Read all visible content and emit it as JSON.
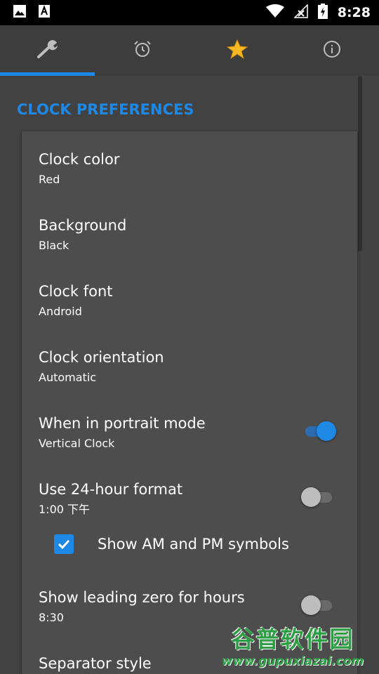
{
  "status_bar": {
    "time": "8:28",
    "icons": [
      "image-icon",
      "a-icon",
      "wifi-icon",
      "signal-icon",
      "battery-icon"
    ]
  },
  "tabs": [
    {
      "icon": "wrench-icon",
      "selected": true
    },
    {
      "icon": "alarm-icon",
      "selected": false
    },
    {
      "icon": "star-icon",
      "selected": false
    },
    {
      "icon": "info-icon",
      "selected": false
    }
  ],
  "section_title": "CLOCK PREFERENCES",
  "prefs": {
    "clock_color": {
      "title": "Clock color",
      "value": "Red"
    },
    "background": {
      "title": "Background",
      "value": "Black"
    },
    "clock_font": {
      "title": "Clock font",
      "value": "Android"
    },
    "clock_orientation": {
      "title": "Clock orientation",
      "value": "Automatic"
    },
    "portrait_mode": {
      "title": "When in portrait mode",
      "value": "Vertical Clock",
      "enabled": true
    },
    "hour_format": {
      "title": "Use 24-hour format",
      "value": "1:00 下午",
      "enabled": false
    },
    "am_pm": {
      "label": "Show AM and PM symbols",
      "checked": true
    },
    "leading_zero": {
      "title": "Show leading zero for hours",
      "value": "8:30",
      "enabled": false
    },
    "separator_style": {
      "title": "Separator style"
    }
  },
  "watermark": {
    "name": "谷普软件园",
    "url": "www.gupuxiazai.com"
  },
  "colors": {
    "accent": "#1e88e5",
    "background": "#424242",
    "card": "#4d4d4d"
  }
}
